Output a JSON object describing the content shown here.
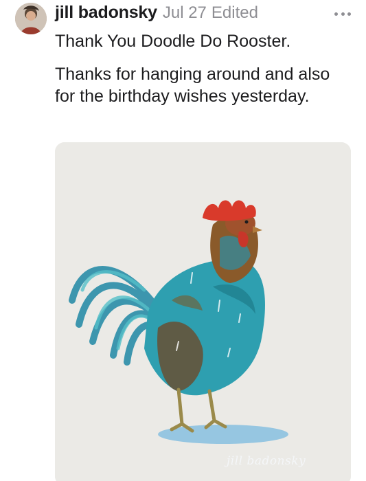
{
  "post": {
    "author": "jill badonsky",
    "date": "Jul 27",
    "edited": "Edited",
    "title": "Thank You Doodle Do Rooster.",
    "body": "Thanks for hanging around and also for the birthday wishes yesterday.",
    "more_icon": "more-horizontal-icon",
    "avatar": "user-avatar",
    "image": {
      "subject": "watercolor rooster painting",
      "signature": "jill badonsky"
    }
  },
  "colors": {
    "text": "#1c1c1e",
    "secondary": "#8e8e93",
    "paper": "#ebeae6",
    "rooster_teal": "#2fa3b3",
    "rooster_comb": "#d93a2b"
  }
}
